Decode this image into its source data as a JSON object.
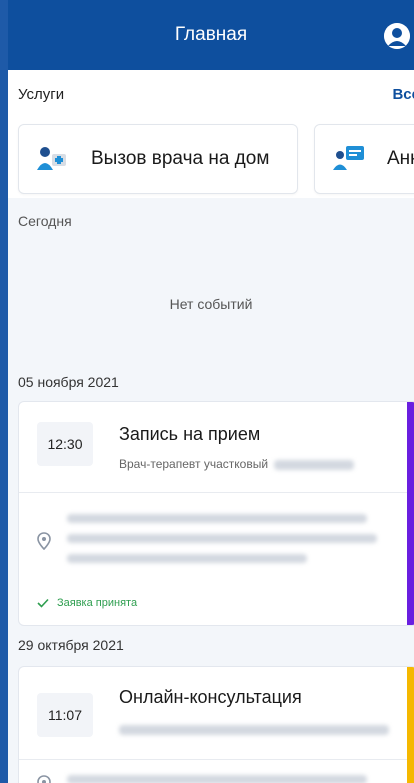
{
  "header": {
    "title": "Главная"
  },
  "services": {
    "title": "Услуги",
    "all_link": "Все",
    "cards": [
      {
        "label": "Вызов врача на дом",
        "icon": "doctor-visit-icon"
      },
      {
        "label": "Анк",
        "icon": "questionnaire-icon"
      }
    ]
  },
  "today": {
    "label": "Сегодня",
    "empty_text": "Нет событий"
  },
  "events": [
    {
      "date": "05 ноября 2021",
      "time": "12:30",
      "title": "Запись на прием",
      "subtitle": "Врач-терапевт участковый",
      "status": "Заявка принята",
      "accent": "#6a1fe0"
    },
    {
      "date": "29 октября 2021",
      "time": "11:07",
      "title": "Онлайн-консультация",
      "accent": "#f5b800"
    }
  ],
  "colors": {
    "primary": "#0e4f9e",
    "status_ok": "#2e9e4f"
  }
}
